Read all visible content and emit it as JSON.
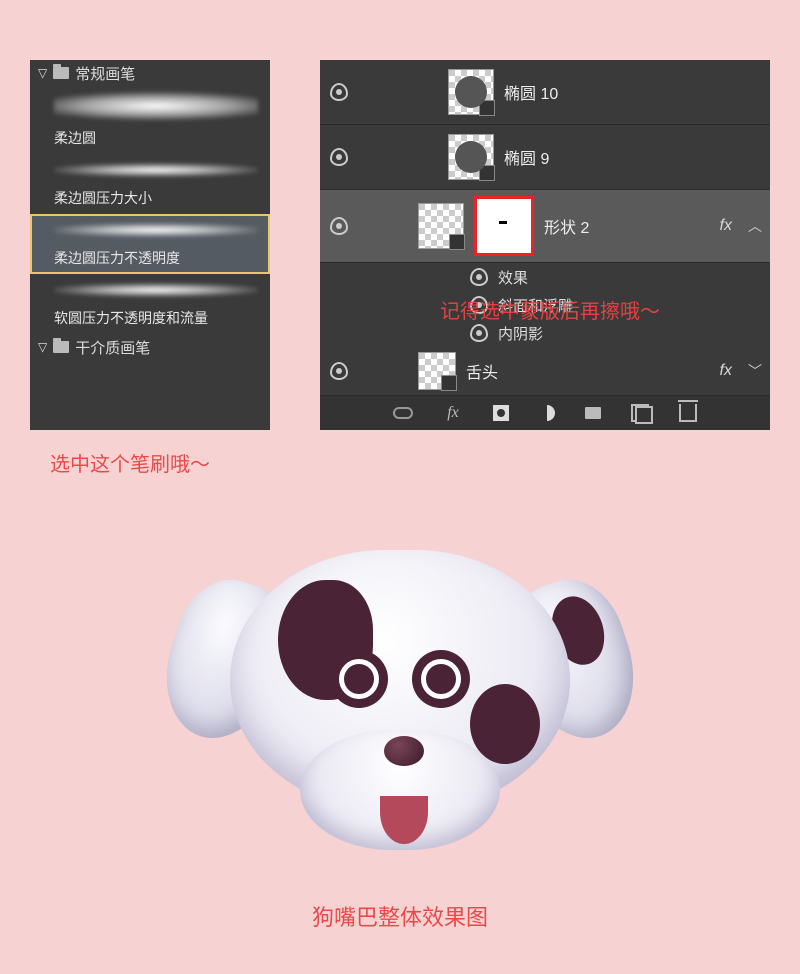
{
  "brush_panel": {
    "groups": [
      {
        "label": "常规画笔",
        "expanded": true
      },
      {
        "label": "干介质画笔",
        "expanded": true
      }
    ],
    "brushes": [
      {
        "label": "柔边圆",
        "selected": false
      },
      {
        "label": "柔边圆压力大小",
        "selected": false
      },
      {
        "label": "柔边圆压力不透明度",
        "selected": true
      },
      {
        "label": "软圆压力不透明度和流量",
        "selected": false
      }
    ],
    "caption": "选中这个笔刷哦～"
  },
  "layers_panel": {
    "note": "记得选中蒙版后再擦哦～",
    "layers": [
      {
        "name": "椭圆 10",
        "visible": true,
        "has_mask": false,
        "selected": false,
        "has_fx": false
      },
      {
        "name": "椭圆 9",
        "visible": true,
        "has_mask": false,
        "selected": false,
        "has_fx": false
      },
      {
        "name": "形状 2",
        "visible": true,
        "has_mask": true,
        "selected": true,
        "has_fx": true,
        "fx_label": "fx",
        "effects_title": "效果",
        "effects": [
          "斜面和浮雕",
          "内阴影"
        ]
      },
      {
        "name": "舌头",
        "visible": true,
        "has_mask": false,
        "selected": false,
        "has_fx": true,
        "fx_label": "fx"
      }
    ],
    "toolbar": [
      "link",
      "fx",
      "mask",
      "adjust",
      "group",
      "new",
      "trash"
    ]
  },
  "dog": {
    "caption": "狗嘴巴整体效果图"
  }
}
